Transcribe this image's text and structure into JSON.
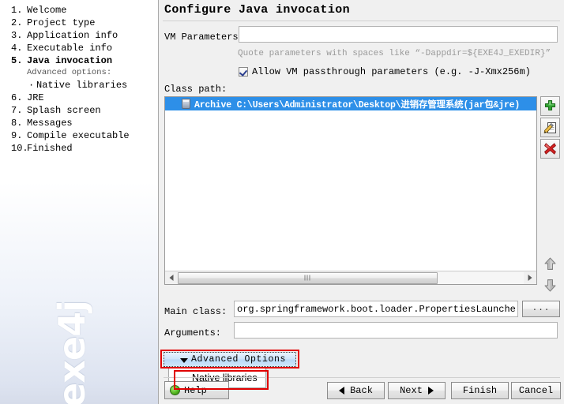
{
  "sidebar": {
    "steps": [
      {
        "num": "1.",
        "label": "Welcome",
        "current": false,
        "type": "step"
      },
      {
        "num": "2.",
        "label": "Project type",
        "current": false,
        "type": "step"
      },
      {
        "num": "3.",
        "label": "Application info",
        "current": false,
        "type": "step"
      },
      {
        "num": "4.",
        "label": "Executable info",
        "current": false,
        "type": "step"
      },
      {
        "num": "5.",
        "label": "Java invocation",
        "current": true,
        "type": "step"
      },
      {
        "num": "",
        "label": "Advanced options:",
        "current": false,
        "type": "sub"
      },
      {
        "num": "·",
        "label": "Native libraries",
        "current": false,
        "type": "bullet"
      },
      {
        "num": "6.",
        "label": "JRE",
        "current": false,
        "type": "step"
      },
      {
        "num": "7.",
        "label": "Splash screen",
        "current": false,
        "type": "step"
      },
      {
        "num": "8.",
        "label": "Messages",
        "current": false,
        "type": "step"
      },
      {
        "num": "9.",
        "label": "Compile executable",
        "current": false,
        "type": "step"
      },
      {
        "num": "10.",
        "label": "Finished",
        "current": false,
        "type": "step"
      }
    ],
    "watermark": "exe4j"
  },
  "main": {
    "title": "Configure Java invocation",
    "vm_parameters": {
      "label": "VM Parameters:",
      "value": "",
      "placeholder": "",
      "hint": "Quote parameters with spaces like “-Dappdir=${EXE4J_EXEDIR}”"
    },
    "allow_passthrough": {
      "label": "Allow VM passthrough parameters (e.g. -J-Xmx256m)",
      "checked": true
    },
    "class_path": {
      "label": "Class path:",
      "entries": [
        {
          "prefix": "Archive",
          "path": "C:\\Users\\Administrator\\Desktop\\进销存管理系统(jar包&jre)",
          "text": "Archive C:\\Users\\Administrator\\Desktop\\进销存管理系统(jar包&jre)",
          "selected": true,
          "icon": "jar-archive-icon"
        }
      ],
      "toolbar": [
        {
          "name": "add-classpath-entry-button",
          "icon": "green-plus-icon"
        },
        {
          "name": "edit-classpath-entry-button",
          "icon": "pencil-notepad-icon"
        },
        {
          "name": "remove-classpath-entry-button",
          "icon": "red-x-icon"
        },
        {
          "name": "move-up-button",
          "icon": "gray-up-arrow-icon"
        },
        {
          "name": "move-down-button",
          "icon": "gray-down-arrow-icon"
        }
      ],
      "scrollbar": {
        "thumb_percent": 75
      }
    },
    "main_class": {
      "label": "Main class:",
      "value": "org.springframework.boot.loader.PropertiesLauncher",
      "browse_label": "..."
    },
    "arguments": {
      "label": "Arguments:",
      "value": "",
      "placeholder": ""
    },
    "advanced_options": {
      "label": "Advanced Options",
      "expanded": true,
      "menu_items": [
        {
          "label": "Native libraries"
        }
      ]
    }
  },
  "footer": {
    "help_label": "Help",
    "back_label": "Back",
    "next_label": "Next",
    "finish_label": "Finish",
    "cancel_label": "Cancel"
  },
  "colors": {
    "selection_blue": "#2d8fe8",
    "annotation_red": "#e00000",
    "advanced_button_blue": "#cde4fa",
    "sidebar_gradient_bottom": "#d6dcea",
    "add_icon_green": "#2fa02f",
    "delete_icon_red": "#d42020"
  }
}
